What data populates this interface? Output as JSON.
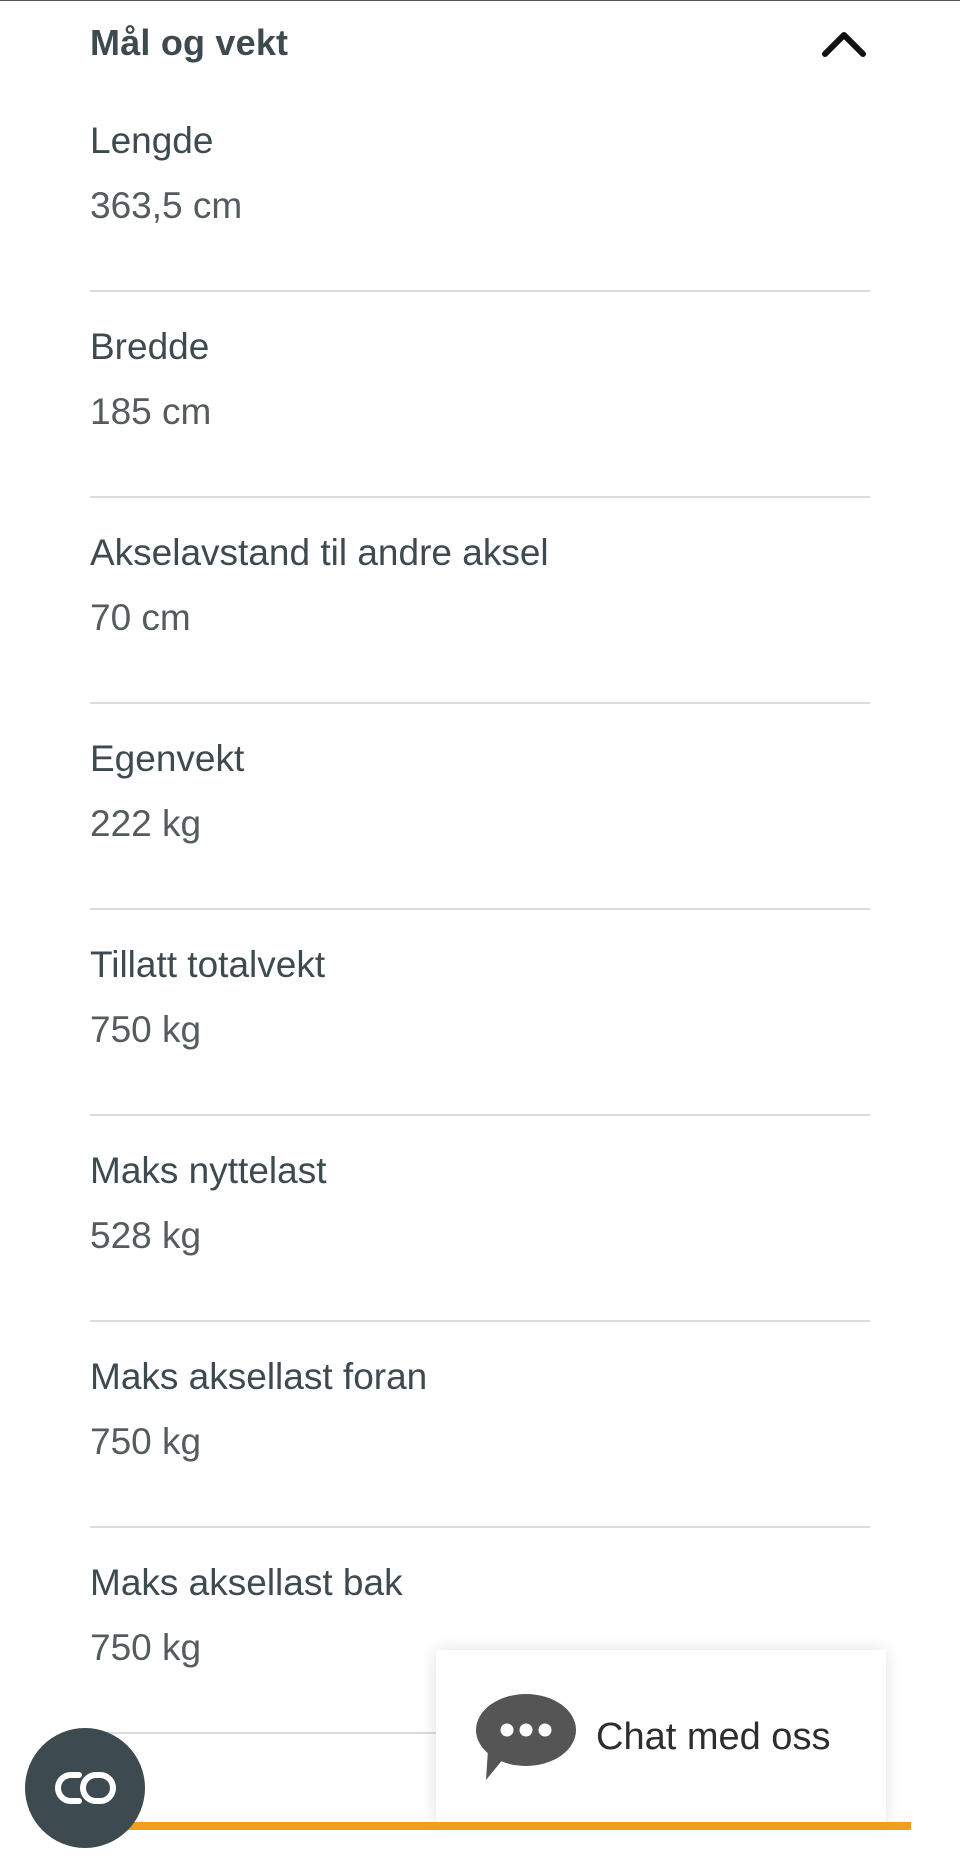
{
  "section": {
    "title": "Mål og vekt",
    "collapse_icon": "chevron-up-icon"
  },
  "specs": [
    {
      "label": "Lengde",
      "value": "363,5 cm"
    },
    {
      "label": "Bredde",
      "value": "185 cm"
    },
    {
      "label": "Akselavstand til andre aksel",
      "value": "70 cm"
    },
    {
      "label": "Egenvekt",
      "value": "222 kg"
    },
    {
      "label": "Tillatt totalvekt",
      "value": "750 kg"
    },
    {
      "label": "Maks nyttelast",
      "value": "528 kg"
    },
    {
      "label": "Maks aksellast foran",
      "value": "750 kg"
    },
    {
      "label": "Maks aksellast bak",
      "value": "750 kg"
    }
  ],
  "chat": {
    "label": "Chat med oss",
    "icon": "chat-bubble-icon"
  },
  "fab": {
    "icon": "link-icon"
  },
  "colors": {
    "text": "#3d4a4f",
    "accent": "#f29e1a",
    "fab_bg": "#3d4a4f",
    "chat_bubble": "#555555"
  }
}
